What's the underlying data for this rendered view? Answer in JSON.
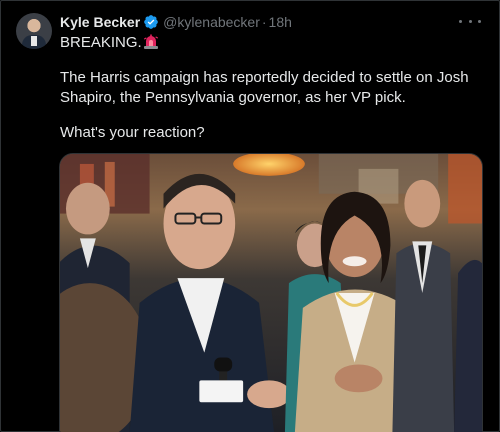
{
  "post": {
    "author_name": "Kyle Becker",
    "handle": "@kylenabecker",
    "separator": "·",
    "time": "18h",
    "line1": "BREAKING.",
    "line2": "The Harris campaign has reportedly decided to settle on Josh",
    "line3": "Shapiro, the Pennsylvania governor, as her VP pick.",
    "line4": "What's your reaction?"
  },
  "icons": {
    "verified": "verified-badge-icon",
    "siren": "police-light-emoji",
    "more": "more-options-icon"
  },
  "colors": {
    "background": "#000000",
    "text_primary": "#e7e9ea",
    "text_secondary": "#71767b",
    "verified_blue": "#1d9bf0"
  }
}
